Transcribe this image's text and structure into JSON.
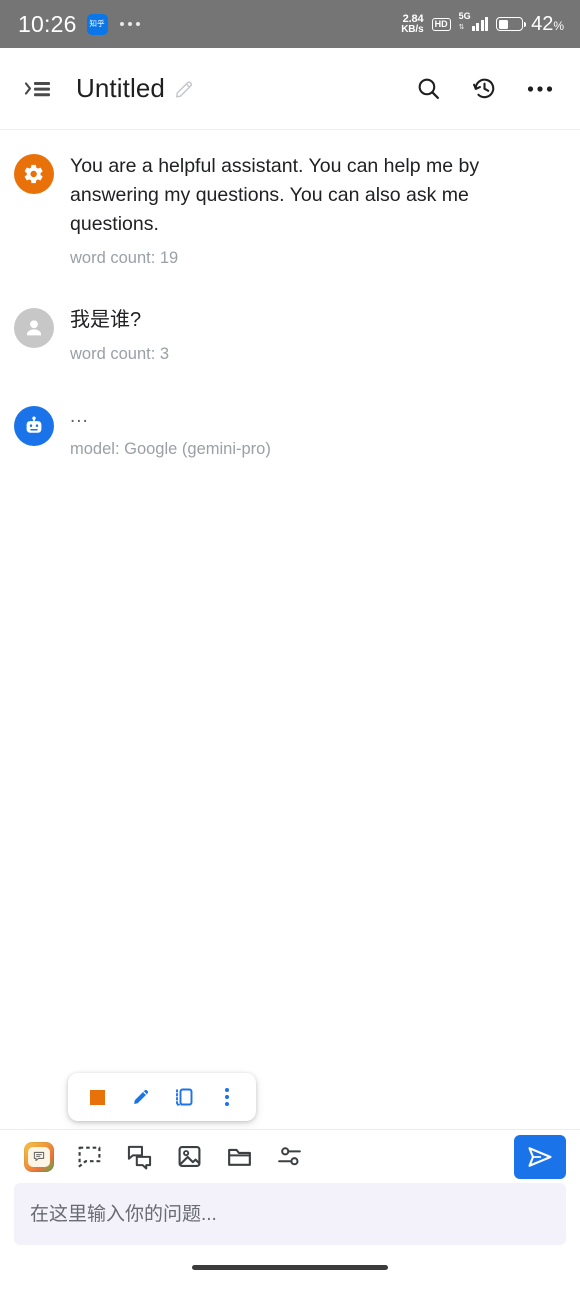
{
  "status_bar": {
    "time": "10:26",
    "app_badge": "知乎",
    "network_speed_value": "2.84",
    "network_speed_unit": "KB/s",
    "hd_label": "HD",
    "network_type": "5G",
    "battery_percent": "42",
    "battery_percent_symbol": "%",
    "background_color": "#757575"
  },
  "app_bar": {
    "menu_icon": "format-indent-icon",
    "title": "Untitled",
    "edit_icon": "pencil-icon",
    "search_icon": "search-icon",
    "history_icon": "history-icon",
    "more_icon": "more-horizontal-icon"
  },
  "chat": {
    "messages": [
      {
        "role": "system",
        "avatar_icon": "gear-icon",
        "avatar_color": "#E8710A",
        "text": "You are a helpful assistant. You can help me by answering my questions. You can also ask me questions.",
        "meta": "word count: 19"
      },
      {
        "role": "user",
        "avatar_icon": "person-icon",
        "avatar_color": "#c7c7c7",
        "text": "我是谁?",
        "meta": "word count: 3"
      },
      {
        "role": "assistant",
        "avatar_icon": "robot-icon",
        "avatar_color": "#1a73e8",
        "text": "...",
        "meta": "model: Google (gemini-pro)"
      }
    ]
  },
  "float_toolbar": {
    "stop_label": "stop-square-icon",
    "edit_label": "pencil-icon",
    "copy_label": "duplicate-icon",
    "more_label": "more-vertical-icon",
    "accent_color": "#1a73e8",
    "stop_color": "#E8710A"
  },
  "bottom_toolbar": {
    "items": [
      {
        "icon": "app-logo-icon"
      },
      {
        "icon": "dashed-speech-bubble-icon"
      },
      {
        "icon": "multi-chat-icon"
      },
      {
        "icon": "image-icon"
      },
      {
        "icon": "folder-icon"
      },
      {
        "icon": "settings-sliders-icon"
      }
    ],
    "send_icon": "send-icon",
    "send_color": "#1a73e8"
  },
  "input": {
    "placeholder": "在这里输入你的问题...",
    "value": "",
    "background_color": "#f3f2fb"
  },
  "navigation": {
    "gesture_pill": "home-gesture-pill"
  }
}
